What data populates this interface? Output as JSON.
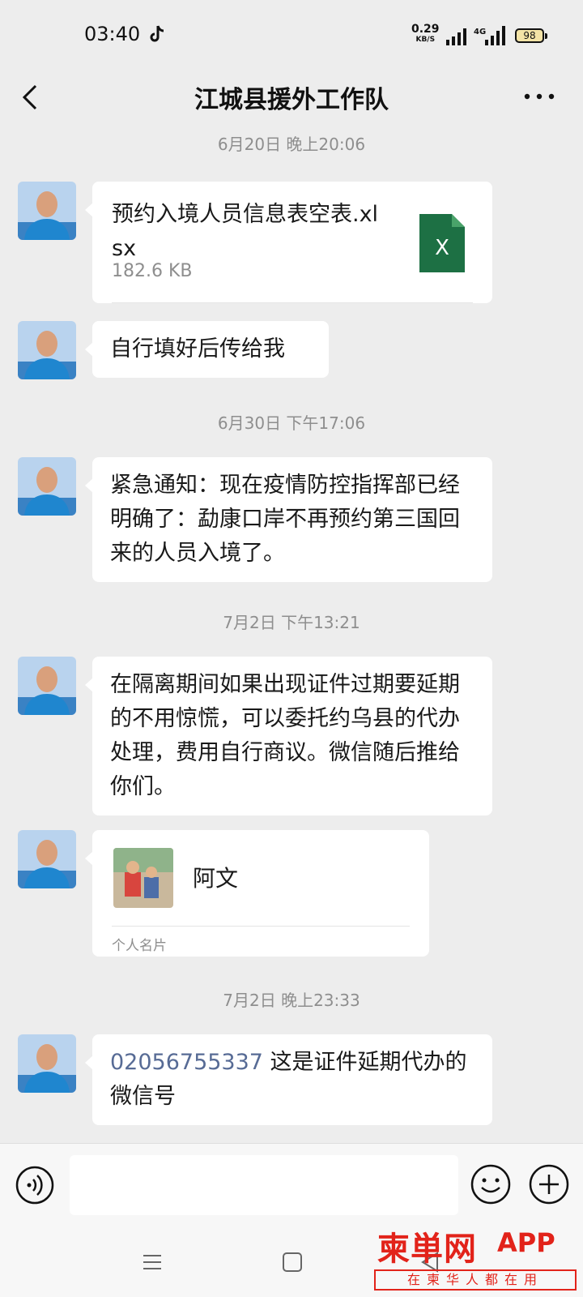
{
  "status_bar": {
    "time": "03:40",
    "net_speed": "0.29",
    "net_speed_unit": "KB/S",
    "network_type": "4G",
    "battery": "98"
  },
  "header": {
    "title": "江城县援外工作队",
    "back_icon": "chevron-left-icon",
    "more_icon": "more-dots-icon"
  },
  "messages": [
    {
      "timestamp": "6月20日 晚上20:06"
    },
    {
      "type": "file",
      "file_name": "预约入境人员信息表空表.xlsx",
      "file_size": "182.6 KB",
      "file_icon": "excel-icon",
      "icon_letter": "X",
      "icon_color": "#1d7044"
    },
    {
      "type": "text",
      "text": "自行填好后传给我"
    },
    {
      "timestamp": "6月30日 下午17:06"
    },
    {
      "type": "text",
      "text": "紧急通知：现在疫情防控指挥部已经明确了：勐康口岸不再预约第三国回来的人员入境了。"
    },
    {
      "timestamp": "7月2日 下午13:21"
    },
    {
      "type": "text",
      "text": "在隔离期间如果出现证件过期要延期的不用惊慌，可以委托约乌县的代办处理，费用自行商议。微信随后推给你们。"
    },
    {
      "type": "contact_card",
      "name": "阿文",
      "label": "个人名片"
    },
    {
      "timestamp": "7月2日 晚上23:33"
    },
    {
      "type": "text",
      "link": "02056755337",
      "text": " 这是证件延期代办的微信号"
    }
  ],
  "input_bar": {
    "voice_icon": "voice-icon",
    "emoji_icon": "emoji-icon",
    "plus_icon": "plus-icon",
    "placeholder": ""
  },
  "nav_bar": {
    "icons": [
      "menu-icon",
      "home-icon",
      "back-triangle-icon"
    ]
  },
  "watermark": {
    "logo": "柬単网",
    "app": "APP",
    "slogan": "在柬华人都在用"
  },
  "colors": {
    "background": "#ededed",
    "bubble": "#ffffff",
    "link": "#576b95",
    "watermark": "#e2231a"
  }
}
